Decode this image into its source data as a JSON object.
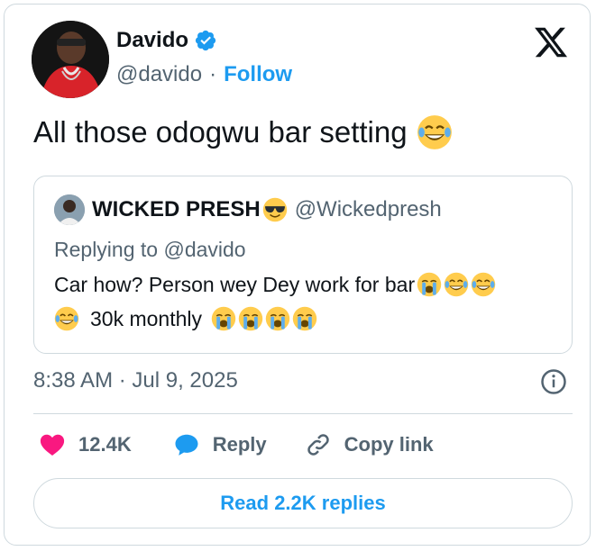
{
  "author": {
    "name": "Davido",
    "handle": "@davido",
    "separator": "·",
    "follow_label": "Follow",
    "verified_color": "#1d9bf0"
  },
  "tweet": {
    "text": "All those odogwu bar setting",
    "emoji": "face-with-tears-of-joy"
  },
  "quoted_tweet": {
    "name": "WICKED PRESH",
    "name_emoji": "smiling-face-with-sunglasses",
    "handle": "@Wickedpresh",
    "replying_prefix": "Replying to",
    "replying_handle": "@davido",
    "line1": "Car how? Person wey Dey work for bar",
    "line1_emojis": [
      "loudly-crying-face",
      "face-with-tears-of-joy",
      "face-with-tears-of-joy"
    ],
    "line2_lead_emoji": "face-with-tears-of-joy",
    "line2": "30k monthly",
    "line2_emojis": [
      "loudly-crying-face",
      "loudly-crying-face",
      "loudly-crying-face",
      "loudly-crying-face"
    ]
  },
  "meta": {
    "timestamp": "8:38 AM · Jul 9, 2025"
  },
  "actions": {
    "likes": "12.4K",
    "reply_label": "Reply",
    "copy_link_label": "Copy link"
  },
  "read_replies_label": "Read 2.2K replies",
  "colors": {
    "accent": "#1d9bf0",
    "like": "#f91880",
    "muted": "#536471",
    "border": "#cfd9de"
  }
}
